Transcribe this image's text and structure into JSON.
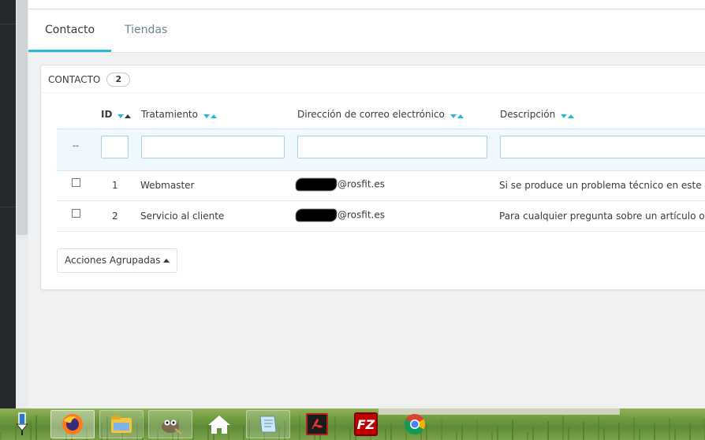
{
  "tabs": [
    {
      "label": "Contacto",
      "active": true
    },
    {
      "label": "Tiendas",
      "active": false
    }
  ],
  "panel": {
    "title": "CONTACTO",
    "count": "2"
  },
  "table": {
    "columns": {
      "id": "ID",
      "tratamiento": "Tratamiento",
      "email": "Dirección de correo electrónico",
      "descripcion": "Descripción"
    },
    "filter_placeholder": "--",
    "rows": [
      {
        "id": "1",
        "tratamiento": "Webmaster",
        "email": "@rosfit.es",
        "descripcion": "Si se produce un problema técnico en este sitio"
      },
      {
        "id": "2",
        "tratamiento": "Servicio al cliente",
        "email": "@rosfit.es",
        "descripcion": "Para cualquier pregunta sobre un artículo o un"
      }
    ]
  },
  "bulk_actions": {
    "label": "Acciones Agrupadas"
  },
  "colors": {
    "accent": "#25b9d7",
    "text": "#363a41"
  },
  "taskbar": {
    "items": [
      {
        "icon": "pin-icon"
      },
      {
        "icon": "firefox-icon"
      },
      {
        "icon": "file-explorer-icon"
      },
      {
        "icon": "gimp-icon"
      },
      {
        "icon": "home-icon"
      },
      {
        "icon": "notepad-icon"
      },
      {
        "icon": "acrobat-icon"
      },
      {
        "icon": "filezilla-icon",
        "text": "FZ"
      },
      {
        "icon": "chrome-icon"
      }
    ]
  }
}
